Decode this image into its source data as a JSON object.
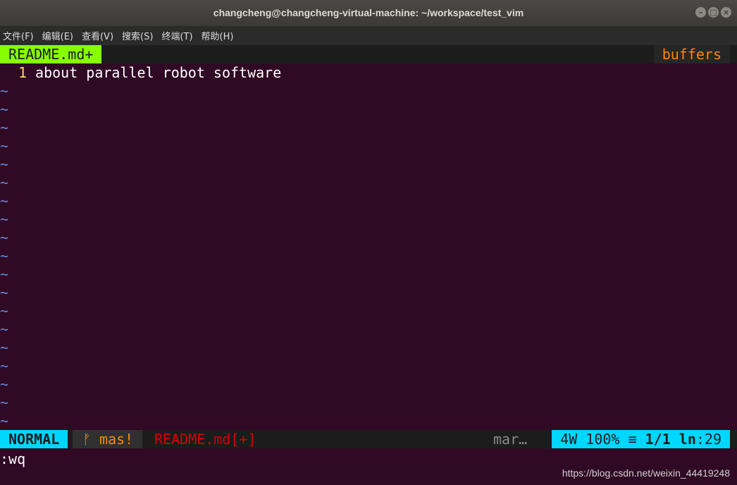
{
  "window": {
    "title": "changcheng@changcheng-virtual-machine: ~/workspace/test_vim",
    "buttons": [
      "–",
      "□",
      "×"
    ]
  },
  "menu": [
    "文件(F)",
    "编辑(E)",
    "查看(V)",
    "搜索(S)",
    "终端(T)",
    "帮助(H)"
  ],
  "tabline": {
    "active_tab": "README.md+",
    "buffers_label": "buffers"
  },
  "editor": {
    "lines": [
      {
        "number": "1",
        "text": "about parallel robot software"
      }
    ],
    "tilde": "~"
  },
  "statusline": {
    "mode": "NORMAL",
    "branch": "ᚠ mas!",
    "file": "README.md[+]",
    "filetype": "mar…",
    "words": "4W",
    "percent": "100%",
    "symbol": "≡",
    "position": "1/1",
    "ln_label": "ln",
    "column": ":29"
  },
  "cmdline": ":wq",
  "watermark": "https://blog.csdn.net/weixin_44419248",
  "colors": {
    "background": "#300a24",
    "tab_active": "#87ff00",
    "mode": "#00d7ff",
    "buffers": "#ff8700",
    "modified_file": "#d70000"
  }
}
